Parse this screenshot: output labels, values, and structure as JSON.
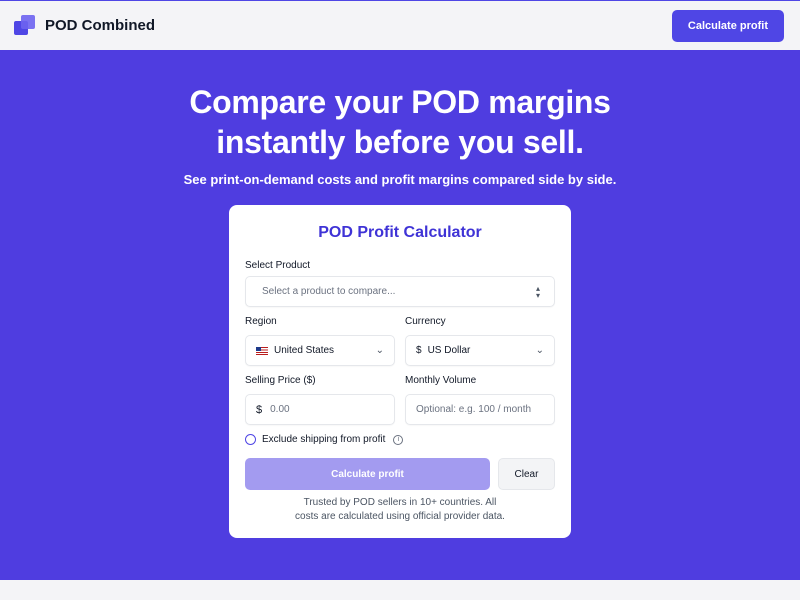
{
  "header": {
    "brand": "POD Combined",
    "cta_label": "Calculate profit"
  },
  "hero": {
    "title_line1": "Compare your POD margins",
    "title_line2": "instantly before you sell.",
    "subtitle": "See print-on-demand costs and profit margins compared side by side."
  },
  "calculator": {
    "title": "POD Profit Calculator",
    "product": {
      "label": "Select Product",
      "placeholder": "Select a product to compare..."
    },
    "region": {
      "label": "Region",
      "value": "United States"
    },
    "currency": {
      "label": "Currency",
      "symbol": "$",
      "value": "US Dollar"
    },
    "selling_price": {
      "label": "Selling Price ($)",
      "prefix": "$",
      "placeholder": "0.00"
    },
    "monthly_volume": {
      "label": "Monthly Volume",
      "placeholder": "Optional: e.g. 100 / month"
    },
    "exclude_shipping": {
      "label": "Exclude shipping from profit",
      "checked": false
    },
    "calculate_label": "Calculate profit",
    "clear_label": "Clear",
    "trust_line1": "Trusted by POD sellers in 10+ countries. All",
    "trust_line2": "costs are calculated using official provider data."
  },
  "colors": {
    "brand": "#4f46e5",
    "hero_bg": "#4f3de0",
    "title_accent": "#3f33d6",
    "button_disabled": "#a39bf0"
  },
  "icons": {
    "logo": "stacked-squares-logo",
    "product_select": "chevron-up-down-icon",
    "region_select": "chevron-down-icon",
    "currency_select": "chevron-down-icon",
    "region_flag": "us-flag-icon",
    "info": "info-icon"
  }
}
